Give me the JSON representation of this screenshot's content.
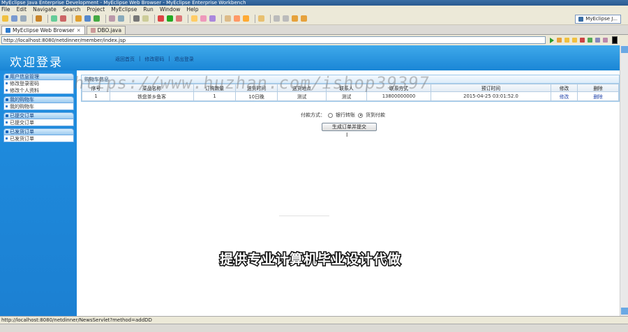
{
  "window": {
    "title": "MyEclipse Java Enterprise Development - MyEclipse Web Browser - MyEclipse Enterprise Workbench"
  },
  "menu": [
    "File",
    "Edit",
    "Navigate",
    "Search",
    "Project",
    "MyEclipse",
    "Run",
    "Window",
    "Help"
  ],
  "perspective_button": "MyEclipse J...",
  "tabs": [
    {
      "label": "MyEclipse Web Browser",
      "active": true
    },
    {
      "label": "DBO.java",
      "active": false
    }
  ],
  "address": {
    "url": "http://localhost:8080/netdinner/member/index.jsp"
  },
  "page": {
    "welcome": "欢迎登录",
    "header_links": [
      "返回首页",
      "修改密码",
      "退出登录"
    ],
    "sidebar": [
      {
        "head": "用户信息管理",
        "items": [
          "修改登录密码",
          "修改个人资料"
        ]
      },
      {
        "head": "我的购物车",
        "items": [
          "我的购物车"
        ]
      },
      {
        "head": "已提交订单",
        "items": [
          "已提交订单"
        ]
      },
      {
        "head": "已发货订单",
        "items": [
          "已发货订单"
        ]
      }
    ],
    "cart_title": "购物车信息",
    "columns": [
      "序号",
      "菜品名称",
      "订购数量",
      "送货时间",
      "送货地点",
      "联系人",
      "联系方式",
      "预订时间",
      "修改",
      "删除"
    ],
    "rows": [
      [
        "1",
        "铁盘茶乡鱼客",
        "1",
        "10日晚",
        "测试",
        "测试",
        "13800000000",
        "2015-04-25 03:01:52.0",
        "修改",
        "删除"
      ]
    ],
    "payment_label": "付款方式：",
    "payment_options": [
      {
        "label": "银行转账",
        "selected": false
      },
      {
        "label": "货到付款",
        "selected": true
      }
    ],
    "submit_button": "生成订单并提交",
    "cursor_glyph": "I"
  },
  "overlay": {
    "watermark": "https://www.huzhan.com/ishop39397",
    "caption": "提供专业计算机毕业设计代做"
  },
  "status": {
    "text": "http://localhost:8080/netdinner/NewsServlet?method=addDD"
  },
  "colors": {
    "header_blue": "#1a86d6",
    "sidebar_blue": "#1c80d2",
    "table_border": "#b5cde3"
  }
}
